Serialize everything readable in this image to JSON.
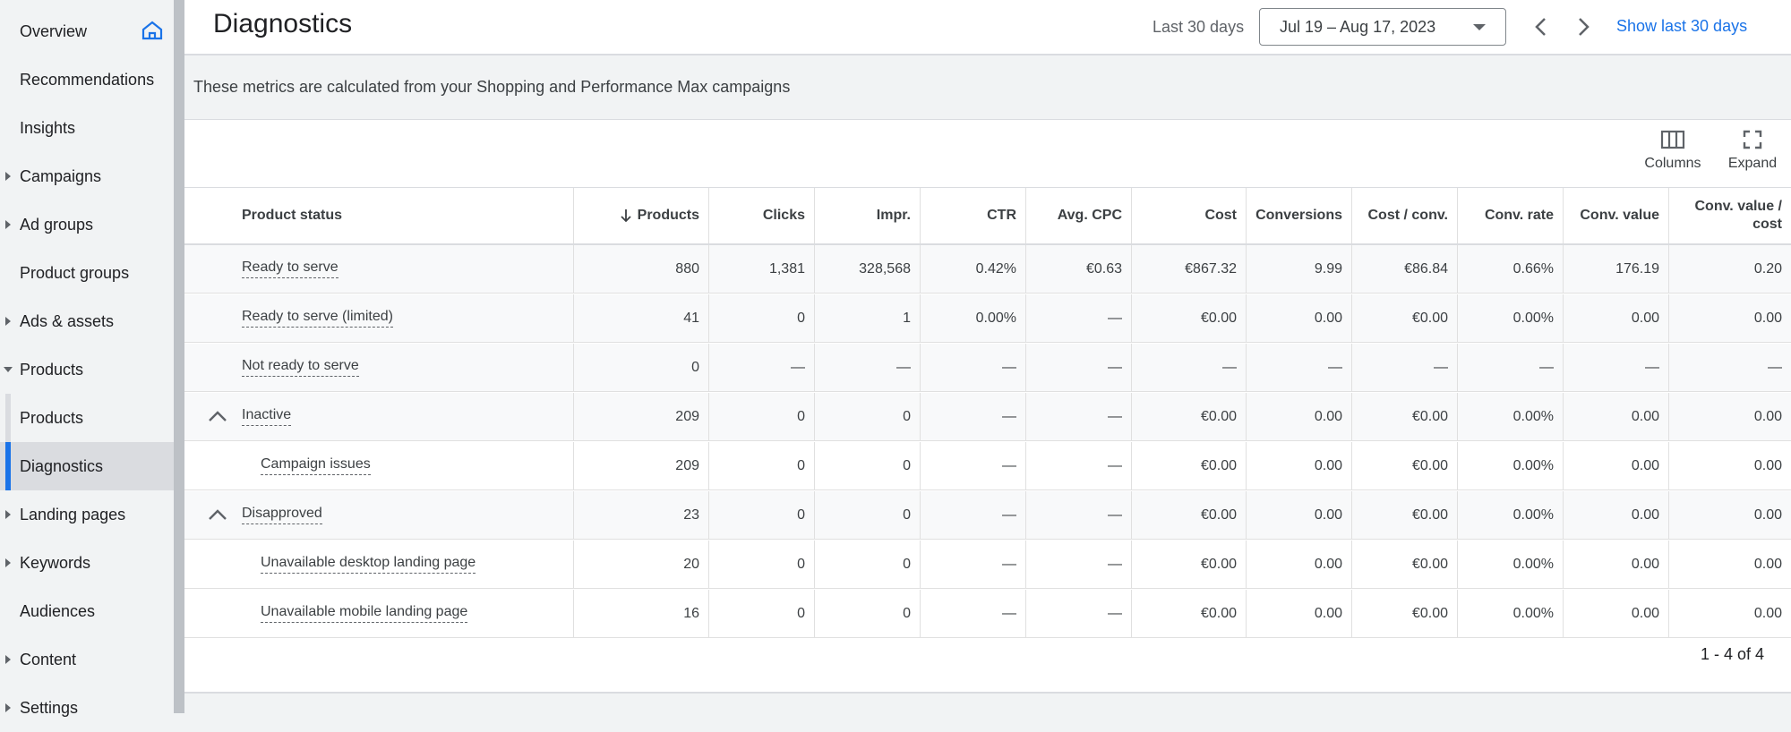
{
  "sidebar": {
    "items": [
      {
        "label": "Overview",
        "caret": "none",
        "sub": false
      },
      {
        "label": "Recommendations",
        "caret": "none",
        "sub": false
      },
      {
        "label": "Insights",
        "caret": "none",
        "sub": false
      },
      {
        "label": "Campaigns",
        "caret": "right",
        "sub": false
      },
      {
        "label": "Ad groups",
        "caret": "right",
        "sub": false
      },
      {
        "label": "Product groups",
        "caret": "none",
        "sub": false
      },
      {
        "label": "Ads & assets",
        "caret": "right",
        "sub": false
      },
      {
        "label": "Products",
        "caret": "down",
        "sub": false
      },
      {
        "label": "Products",
        "caret": "none",
        "sub": true
      },
      {
        "label": "Diagnostics",
        "caret": "none",
        "sub": true,
        "active": true
      },
      {
        "label": "Landing pages",
        "caret": "right",
        "sub": false
      },
      {
        "label": "Keywords",
        "caret": "right",
        "sub": false
      },
      {
        "label": "Audiences",
        "caret": "none",
        "sub": false
      },
      {
        "label": "Content",
        "caret": "right",
        "sub": false
      },
      {
        "label": "Settings",
        "caret": "right",
        "sub": false
      }
    ],
    "home_icon": "home-icon"
  },
  "header": {
    "title": "Diagnostics",
    "range_label": "Last 30 days",
    "date_range": "Jul 19 – Aug 17, 2023",
    "show_last": "Show last 30 days"
  },
  "info": {
    "text": "These metrics are calculated from your Shopping and Performance Max campaigns"
  },
  "toolbar": {
    "columns_label": "Columns",
    "expand_label": "Expand"
  },
  "table": {
    "headers": [
      "Product status",
      "Products",
      "Clicks",
      "Impr.",
      "CTR",
      "Avg. CPC",
      "Cost",
      "Conversions",
      "Cost / conv.",
      "Conv. rate",
      "Conv. value",
      "Conv. value / cost"
    ],
    "sorted_column": "Products",
    "rows": [
      {
        "status": "Ready to serve",
        "level": 0,
        "expandable": false,
        "cells": [
          "880",
          "1,381",
          "328,568",
          "0.42%",
          "€0.63",
          "€867.32",
          "9.99",
          "€86.84",
          "0.66%",
          "176.19",
          "0.20"
        ]
      },
      {
        "status": "Ready to serve (limited)",
        "level": 0,
        "expandable": false,
        "cells": [
          "41",
          "0",
          "1",
          "0.00%",
          "—",
          "€0.00",
          "0.00",
          "€0.00",
          "0.00%",
          "0.00",
          "0.00"
        ]
      },
      {
        "status": "Not ready to serve",
        "level": 0,
        "expandable": false,
        "cells": [
          "0",
          "—",
          "—",
          "—",
          "—",
          "—",
          "—",
          "—",
          "—",
          "—",
          "—"
        ]
      },
      {
        "status": "Inactive",
        "level": 0,
        "expandable": true,
        "cells": [
          "209",
          "0",
          "0",
          "—",
          "—",
          "€0.00",
          "0.00",
          "€0.00",
          "0.00%",
          "0.00",
          "0.00"
        ]
      },
      {
        "status": "Campaign issues",
        "level": 1,
        "expandable": false,
        "cells": [
          "209",
          "0",
          "0",
          "—",
          "—",
          "€0.00",
          "0.00",
          "€0.00",
          "0.00%",
          "0.00",
          "0.00"
        ]
      },
      {
        "status": "Disapproved",
        "level": 0,
        "expandable": true,
        "cells": [
          "23",
          "0",
          "0",
          "—",
          "—",
          "€0.00",
          "0.00",
          "€0.00",
          "0.00%",
          "0.00",
          "0.00"
        ]
      },
      {
        "status": "Unavailable desktop landing page",
        "level": 1,
        "expandable": false,
        "cells": [
          "20",
          "0",
          "0",
          "—",
          "—",
          "€0.00",
          "0.00",
          "€0.00",
          "0.00%",
          "0.00",
          "0.00"
        ]
      },
      {
        "status": "Unavailable mobile landing page",
        "level": 1,
        "expandable": false,
        "cells": [
          "16",
          "0",
          "0",
          "—",
          "—",
          "€0.00",
          "0.00",
          "€0.00",
          "0.00%",
          "0.00",
          "0.00"
        ]
      }
    ]
  },
  "pagination": {
    "text": "1 - 4 of 4"
  },
  "colors": {
    "accent": "#1a73e8",
    "sidebar_bg": "#f1f3f4",
    "active_bg": "#dadce0"
  }
}
